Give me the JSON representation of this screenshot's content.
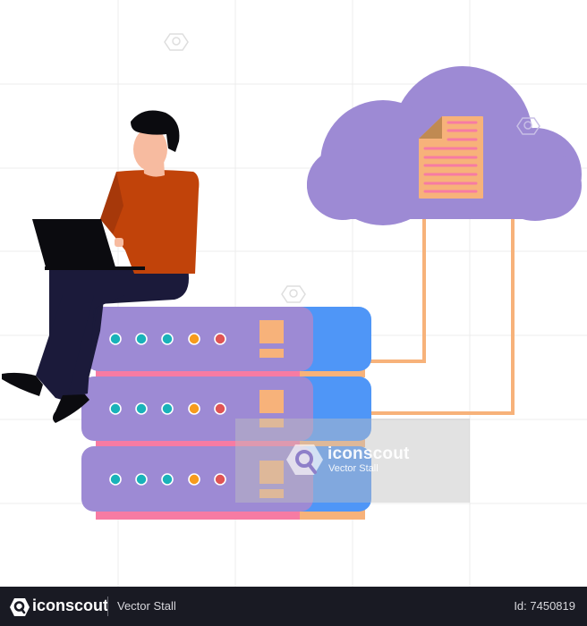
{
  "illustration": {
    "title": "Person with laptop sitting on server stack connected to cloud document storage",
    "colors": {
      "cloud": "#9d8ad4",
      "document": "#f7b27a",
      "document_fold": "#c08a52",
      "document_lines": "#f77ba3",
      "server_front": "#9d8ad4",
      "server_side": "#4f96f7",
      "server_base_pink": "#f77ba3",
      "server_base_orange": "#f7b27a",
      "connector": "#f7b27a",
      "led_teal": "#19b2b9",
      "led_orange": "#f79b1c",
      "led_red": "#e05454",
      "shirt": "#c1430a",
      "pants": "#1b1a3a",
      "skin": "#f7bba0",
      "hair": "#0b0b0f",
      "laptop": "#0b0b0f",
      "grid": "#ececec"
    },
    "server_units": [
      {
        "name": "server-unit-top",
        "leds": [
          "teal",
          "teal",
          "teal",
          "orange",
          "red"
        ]
      },
      {
        "name": "server-unit-middle",
        "leds": [
          "teal",
          "teal",
          "teal",
          "orange",
          "red"
        ]
      },
      {
        "name": "server-unit-bottom",
        "leds": [
          "teal",
          "teal",
          "teal",
          "orange",
          "red"
        ]
      }
    ]
  },
  "watermark": {
    "brand": "iconscout",
    "author": "Vector Stall"
  },
  "footer": {
    "brand": "iconscout",
    "author": "Vector Stall",
    "id_label": "Id: 7450819"
  }
}
